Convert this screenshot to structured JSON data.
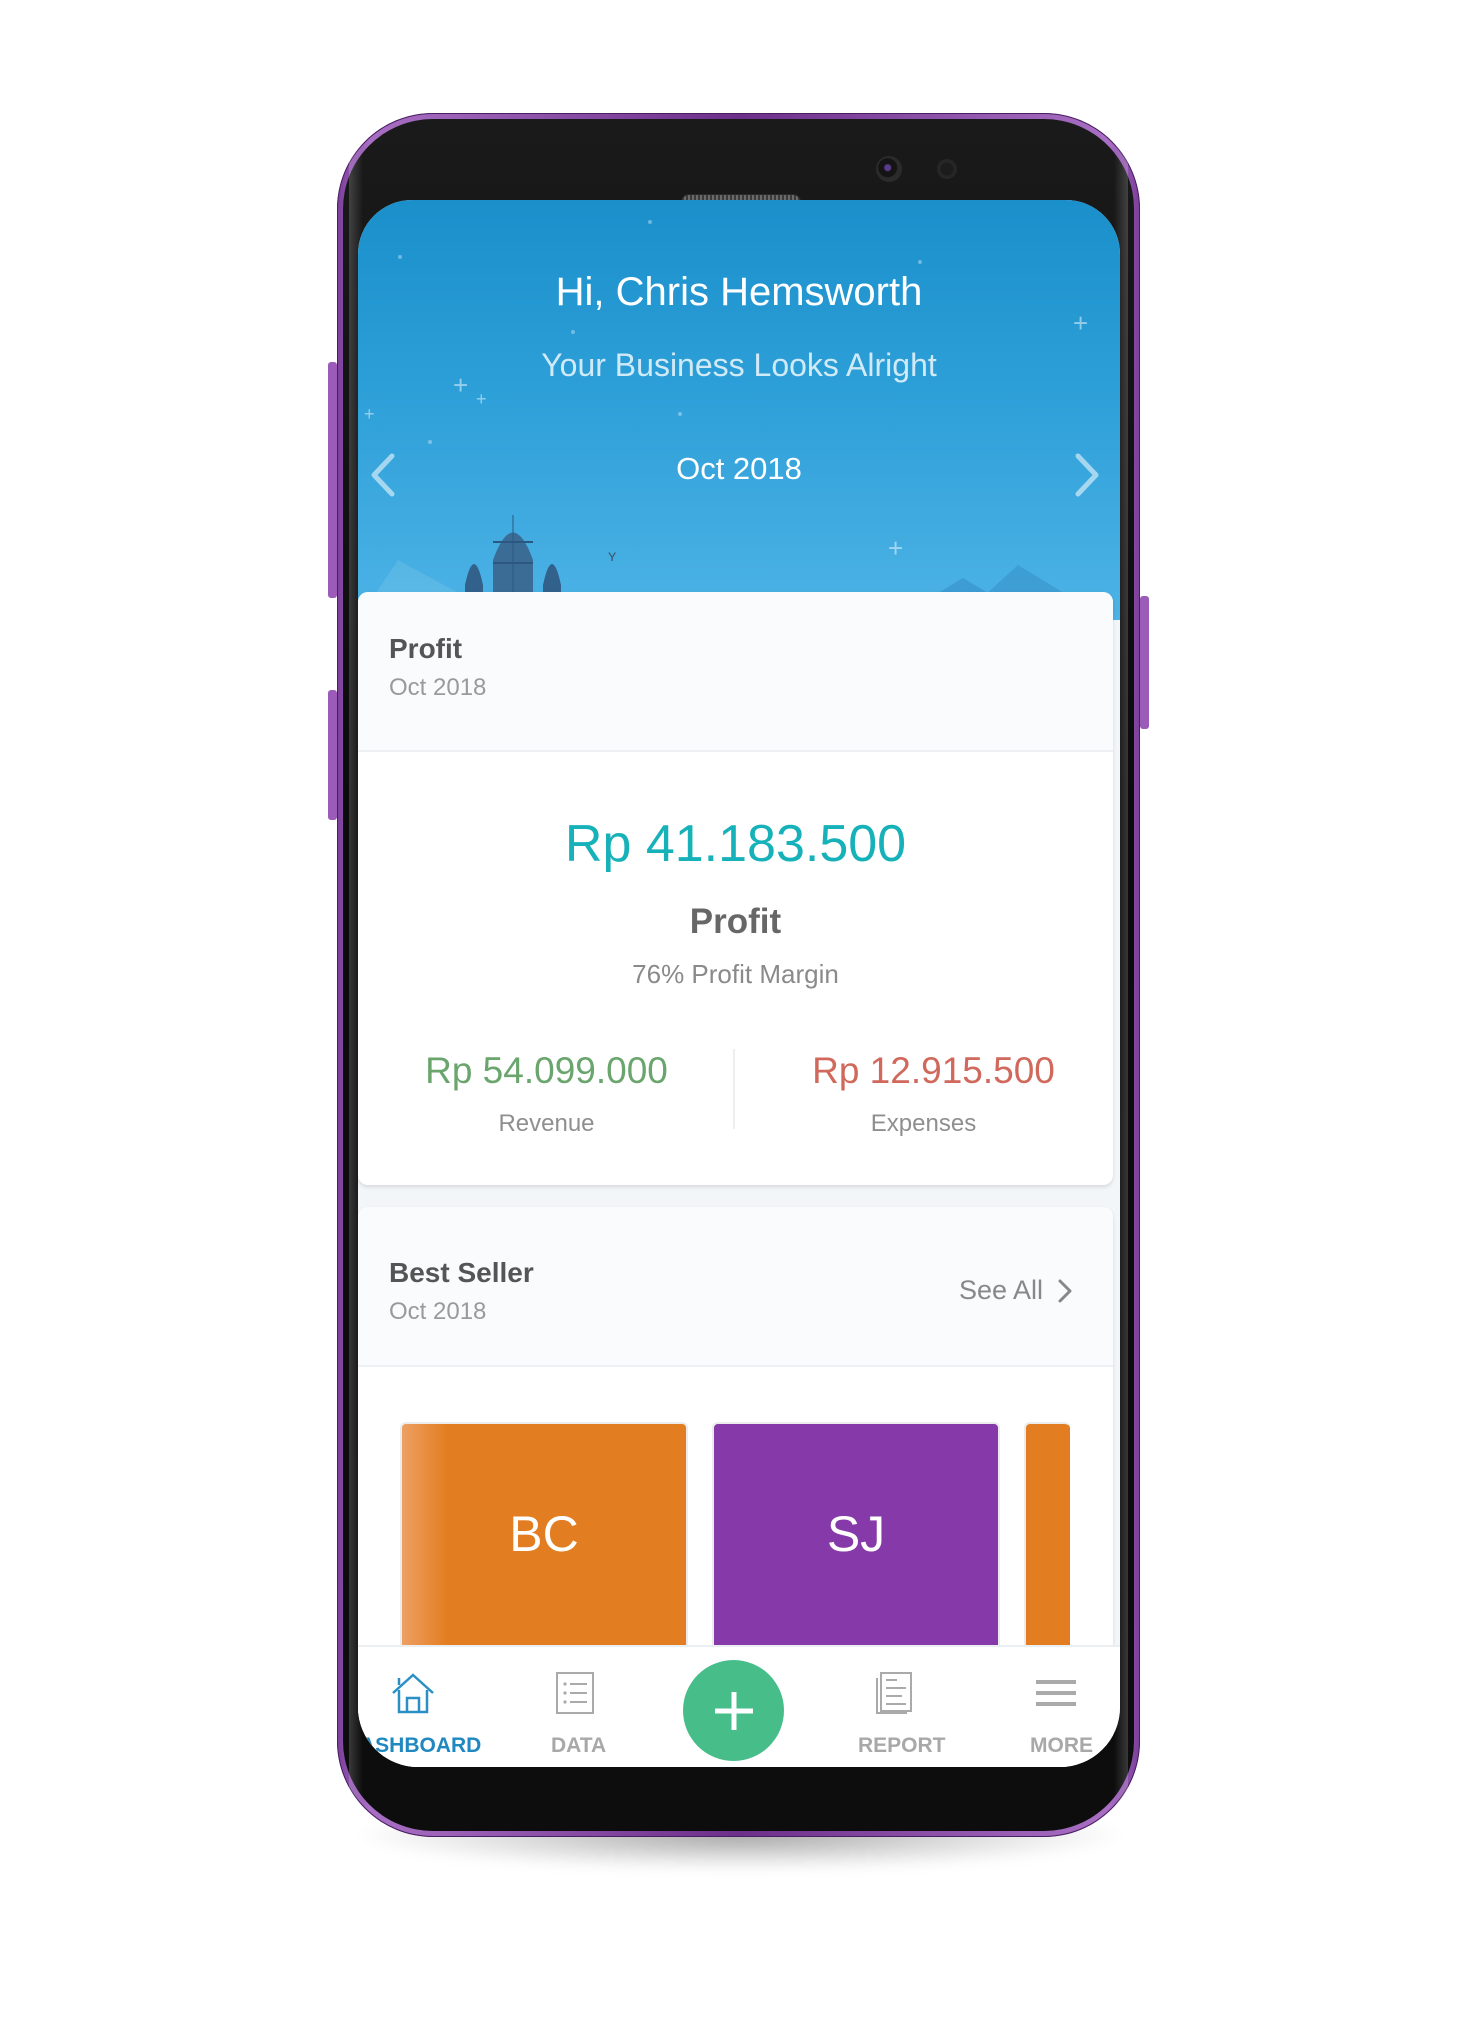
{
  "header": {
    "greeting": "Hi, Chris Hemsworth",
    "subtitle": "Your Business Looks Alright",
    "period": "Oct 2018",
    "prev_icon": "chevron-left-icon",
    "next_icon": "chevron-right-icon"
  },
  "profit_card": {
    "title": "Profit",
    "period": "Oct 2018",
    "amount": "Rp 41.183.500",
    "amount_label": "Profit",
    "margin": "76% Profit Margin",
    "revenue": {
      "amount": "Rp 54.099.000",
      "label": "Revenue"
    },
    "expenses": {
      "amount": "Rp 12.915.500",
      "label": "Expenses"
    }
  },
  "best_seller": {
    "title": "Best Seller",
    "period": "Oct 2018",
    "see_all": "See All",
    "items": [
      {
        "initials": "BC",
        "color": "#e37d22"
      },
      {
        "initials": "SJ",
        "color": "#8639a8"
      },
      {
        "initials": "",
        "color": "#e37d22"
      }
    ]
  },
  "bottom_nav": {
    "items": [
      {
        "label": "ASHBOARD",
        "icon": "home-icon",
        "active": true
      },
      {
        "label": "DATA",
        "icon": "list-icon",
        "active": false
      },
      {
        "label": "",
        "icon": "plus-icon",
        "active": false
      },
      {
        "label": "REPORT",
        "icon": "report-icon",
        "active": false
      },
      {
        "label": "MORE",
        "icon": "menu-icon",
        "active": false
      }
    ]
  },
  "colors": {
    "accent_teal": "#17b1b9",
    "revenue_green": "#6aa56d",
    "expenses_red": "#d0695b",
    "nav_active": "#1f88c0",
    "nav_inactive": "#a8a8a8",
    "fab_green": "#47be8a"
  }
}
